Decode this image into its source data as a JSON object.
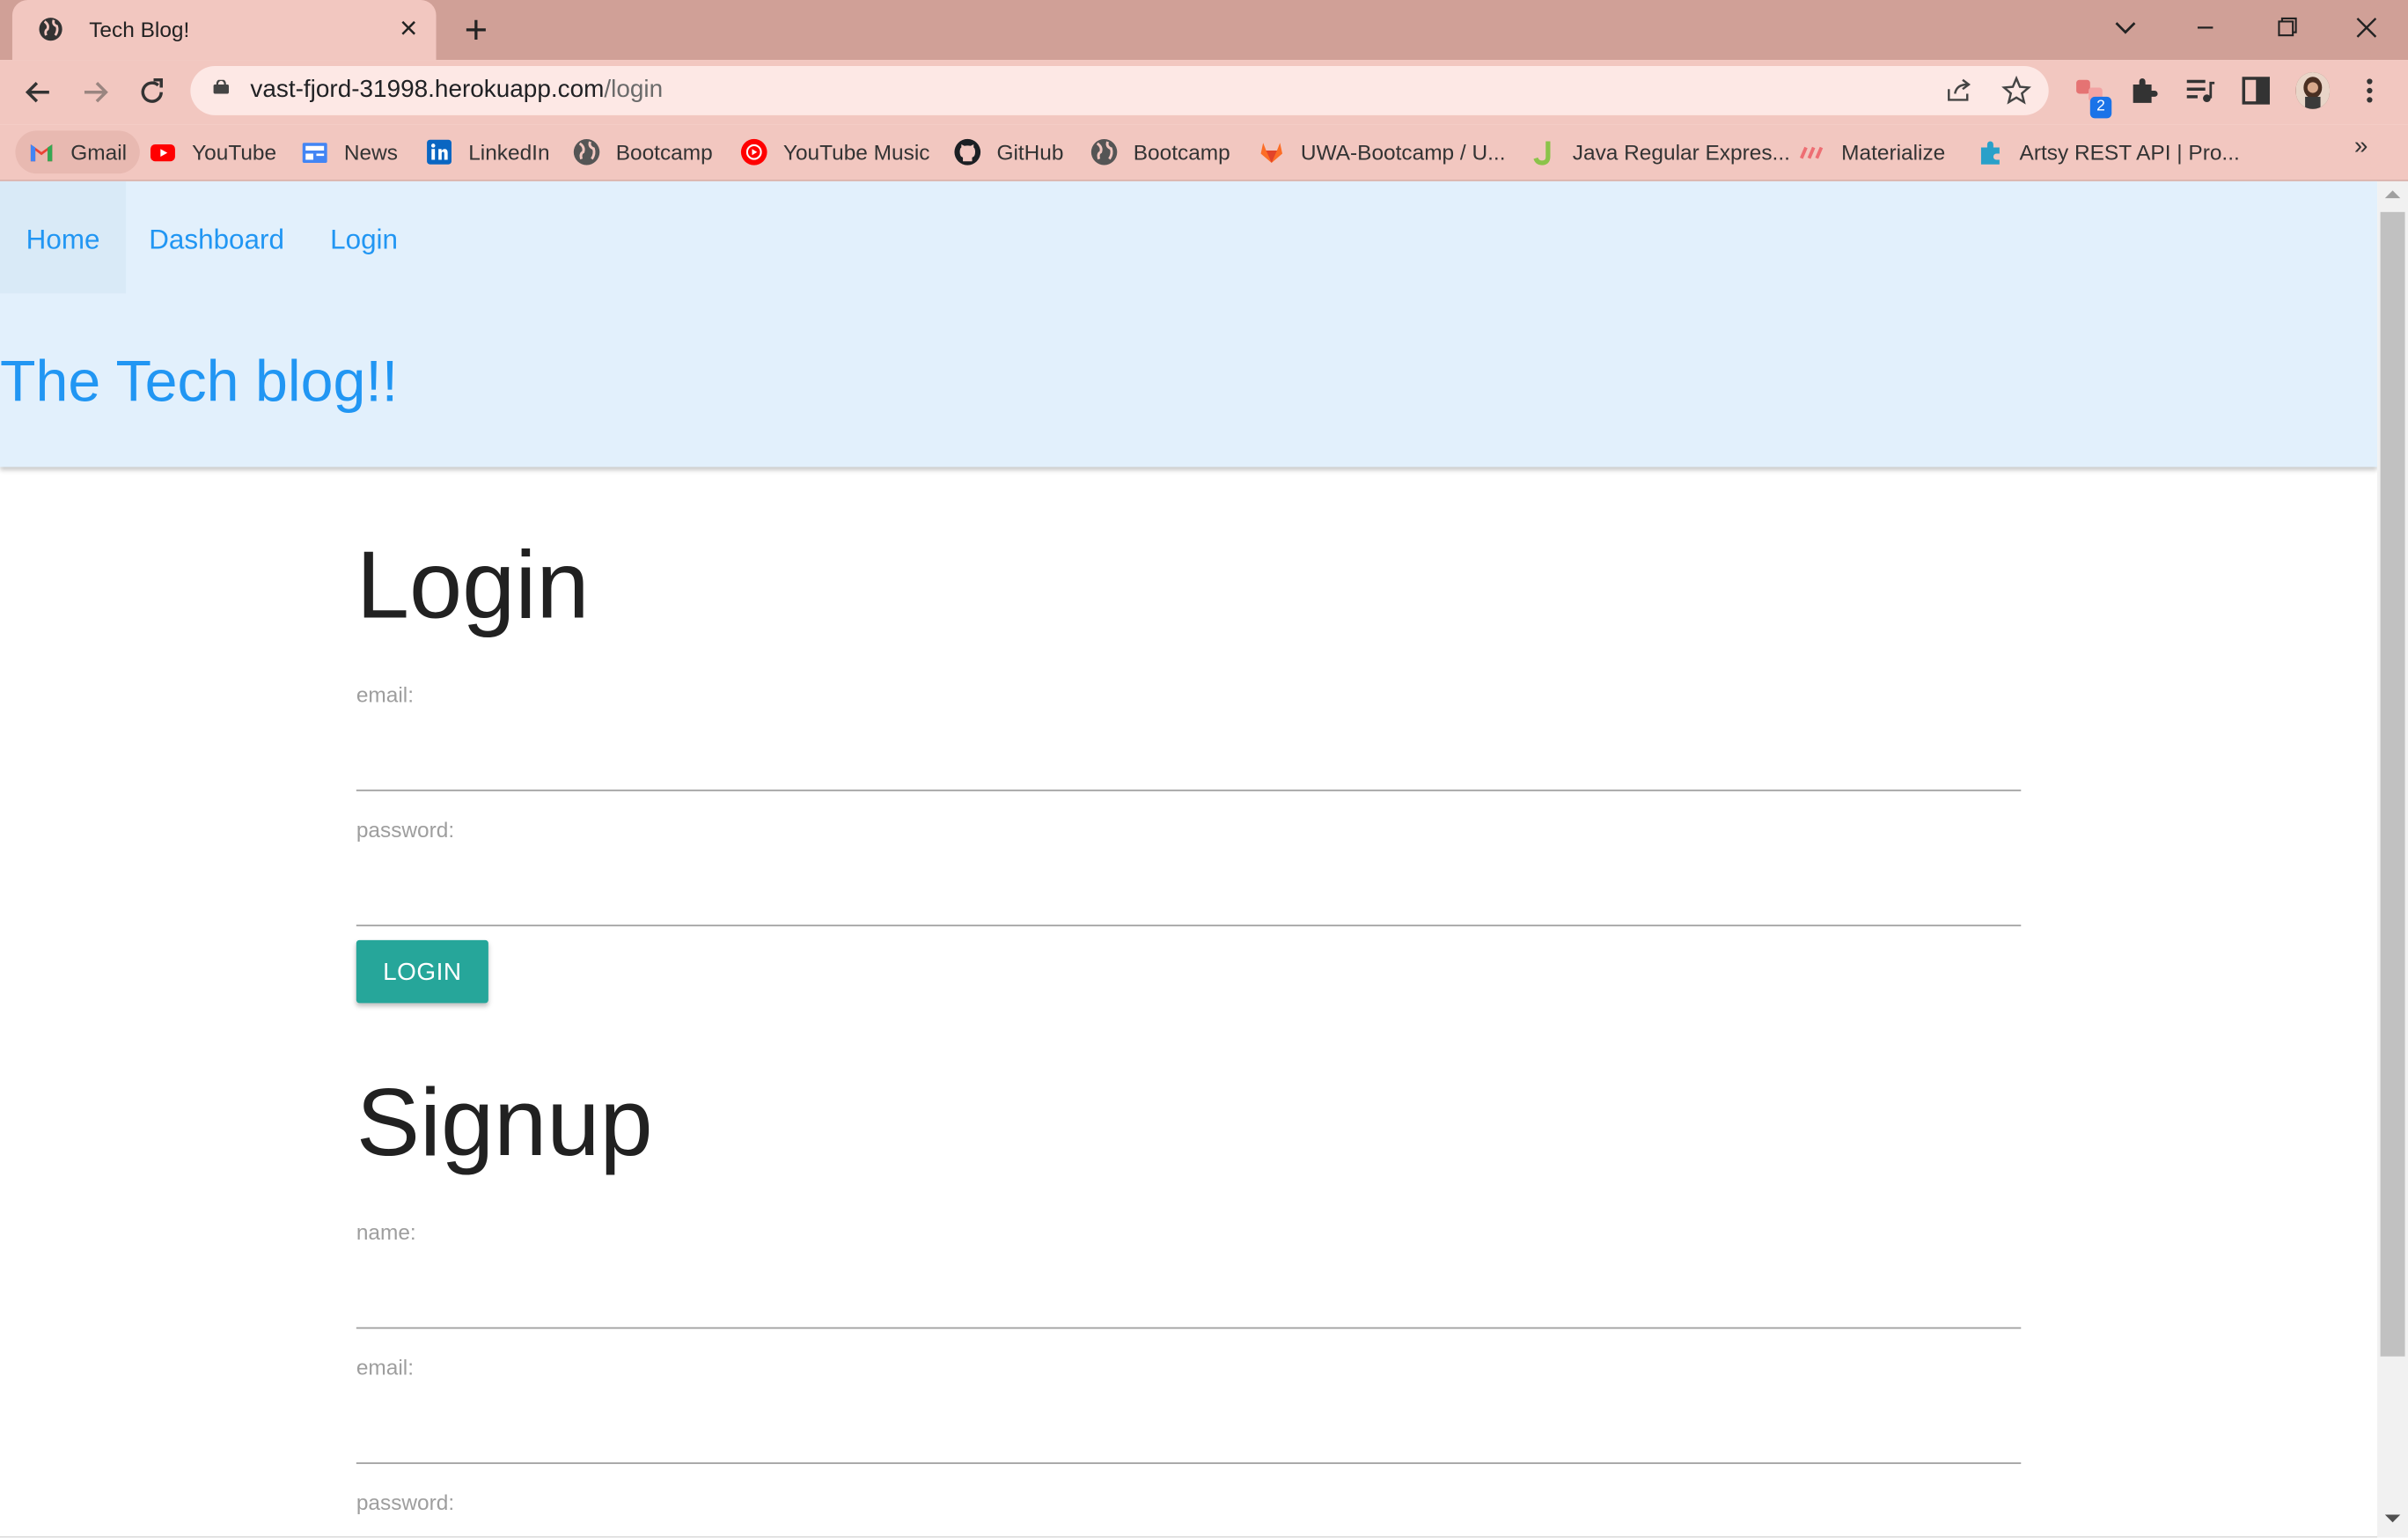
{
  "browser": {
    "tab_title": "Tech Blog!",
    "url_host": "vast-fjord-31998.herokuapp.com",
    "url_path": "/login",
    "extension_badge": "2"
  },
  "bookmarks": [
    {
      "label": "Gmail",
      "icon": "gmail-icon"
    },
    {
      "label": "YouTube",
      "icon": "youtube-icon"
    },
    {
      "label": "News",
      "icon": "news-icon"
    },
    {
      "label": "LinkedIn",
      "icon": "linkedin-icon"
    },
    {
      "label": "Bootcamp",
      "icon": "globe-icon"
    },
    {
      "label": "YouTube Music",
      "icon": "youtube-music-icon"
    },
    {
      "label": "GitHub",
      "icon": "github-icon"
    },
    {
      "label": "Bootcamp",
      "icon": "globe-icon"
    },
    {
      "label": "UWA-Bootcamp / U...",
      "icon": "gitlab-icon"
    },
    {
      "label": "Java Regular Expres...",
      "icon": "j-icon"
    },
    {
      "label": "Materialize",
      "icon": "materialize-icon"
    },
    {
      "label": "Artsy REST API | Pro...",
      "icon": "puzzle-icon"
    }
  ],
  "site": {
    "nav": [
      "Home",
      "Dashboard",
      "Login"
    ],
    "title": "The Tech blog!!"
  },
  "login": {
    "heading": "Login",
    "email_label": "email:",
    "password_label": "password:",
    "button": "LOGIN"
  },
  "signup": {
    "heading": "Signup",
    "name_label": "name:",
    "email_label": "email:",
    "password_label": "password:"
  },
  "colors": {
    "accent": "#2196f3",
    "button": "#26a69a",
    "header_bg": "#e2f0fc",
    "chrome_tab": "#f2c7c0",
    "chrome_frame": "#d0a097"
  }
}
